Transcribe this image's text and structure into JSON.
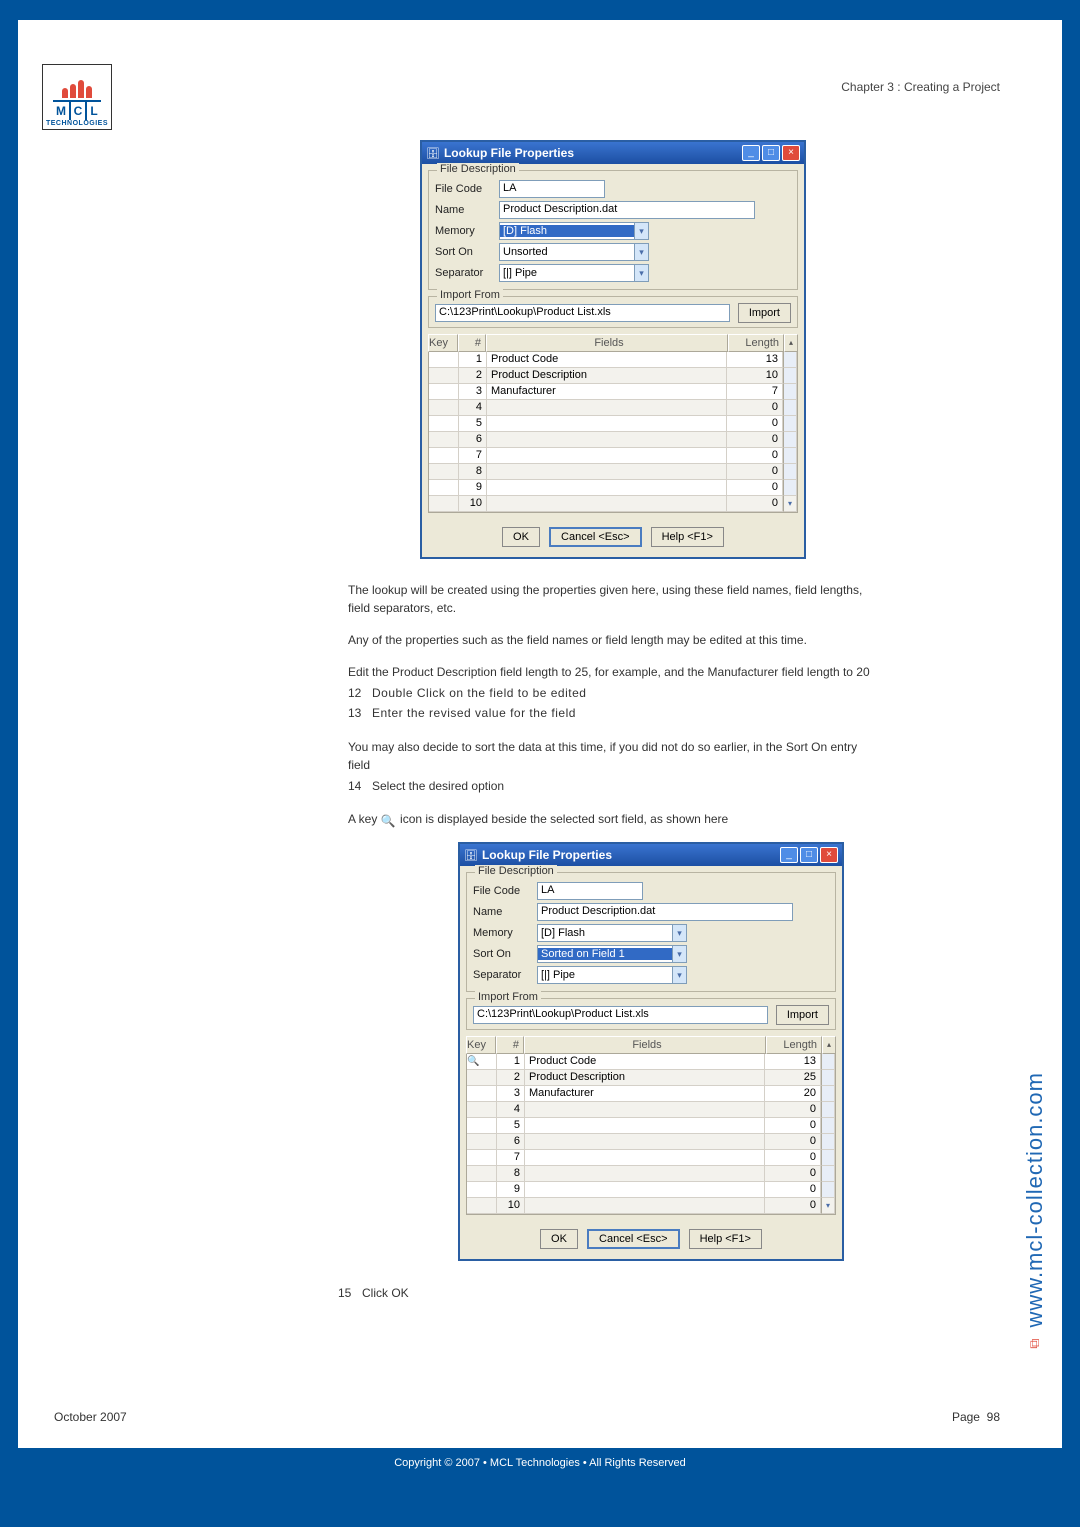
{
  "header": {
    "chapter": "Chapter 3 : Creating a Project"
  },
  "logo": {
    "tech": "TECHNOLOGIES"
  },
  "dialog1": {
    "title": "Lookup File Properties",
    "fs1_legend": "File Description",
    "file_code_lbl": "File Code",
    "file_code": "LA",
    "name_lbl": "Name",
    "name": "Product Description.dat",
    "memory_lbl": "Memory",
    "memory": "[D] Flash",
    "sort_lbl": "Sort On",
    "sort": "Unsorted",
    "sep_lbl": "Separator",
    "sep": "[|] Pipe",
    "fs2_legend": "Import From",
    "import_path": "C:\\123Print\\Lookup\\Product List.xls",
    "import_btn": "Import",
    "col_key": "Key",
    "col_num": "#",
    "col_fields": "Fields",
    "col_len": "Length",
    "rows": [
      {
        "n": "1",
        "f": "Product Code",
        "l": "13"
      },
      {
        "n": "2",
        "f": "Product Description",
        "l": "10"
      },
      {
        "n": "3",
        "f": "Manufacturer",
        "l": "7"
      },
      {
        "n": "4",
        "f": "",
        "l": "0"
      },
      {
        "n": "5",
        "f": "",
        "l": "0"
      },
      {
        "n": "6",
        "f": "",
        "l": "0"
      },
      {
        "n": "7",
        "f": "",
        "l": "0"
      },
      {
        "n": "8",
        "f": "",
        "l": "0"
      },
      {
        "n": "9",
        "f": "",
        "l": "0"
      },
      {
        "n": "10",
        "f": "",
        "l": "0"
      }
    ],
    "ok": "OK",
    "cancel": "Cancel <Esc>",
    "help": "Help <F1>"
  },
  "text": {
    "p1": "The lookup will be created using the properties given here, using these field names, field lengths, field separators, etc.",
    "p2": "Any of the properties such as the field names or field length may be edited at this time.",
    "p3": "Edit the Product Description field length to 25, for example, and the Manufacturer field length to 20",
    "s12n": "12",
    "s12": "Double Click on the field to be edited",
    "s13n": "13",
    "s13": "Enter the revised value for the field",
    "p4": "You may also decide to sort the data at this time, if you did not do so earlier, in the Sort On entry field",
    "s14n": "14",
    "s14": "Select the desired option",
    "p5a": "A key ",
    "p5b": " icon is displayed beside the selected sort field, as shown here",
    "s15n": "15",
    "s15": "Click OK"
  },
  "dialog2": {
    "title": "Lookup File Properties",
    "fs1_legend": "File Description",
    "file_code_lbl": "File Code",
    "file_code": "LA",
    "name_lbl": "Name",
    "name": "Product Description.dat",
    "memory_lbl": "Memory",
    "memory": "[D] Flash",
    "sort_lbl": "Sort On",
    "sort": "Sorted on Field 1",
    "sep_lbl": "Separator",
    "sep": "[|] Pipe",
    "fs2_legend": "Import From",
    "import_path": "C:\\123Print\\Lookup\\Product List.xls",
    "import_btn": "Import",
    "col_key": "Key",
    "col_num": "#",
    "col_fields": "Fields",
    "col_len": "Length",
    "rows": [
      {
        "n": "1",
        "f": "Product Code",
        "l": "13",
        "key": true
      },
      {
        "n": "2",
        "f": "Product Description",
        "l": "25"
      },
      {
        "n": "3",
        "f": "Manufacturer",
        "l": "20"
      },
      {
        "n": "4",
        "f": "",
        "l": "0"
      },
      {
        "n": "5",
        "f": "",
        "l": "0"
      },
      {
        "n": "6",
        "f": "",
        "l": "0"
      },
      {
        "n": "7",
        "f": "",
        "l": "0"
      },
      {
        "n": "8",
        "f": "",
        "l": "0"
      },
      {
        "n": "9",
        "f": "",
        "l": "0"
      },
      {
        "n": "10",
        "f": "",
        "l": "0"
      }
    ],
    "ok": "OK",
    "cancel": "Cancel <Esc>",
    "help": "Help <F1>"
  },
  "footer": {
    "date": "October 2007",
    "page_lbl": "Page",
    "page_num": "98"
  },
  "copyright": "Copyright © 2007 • MCL Technologies • All Rights Reserved",
  "side_url": "www.mcl-collection.com"
}
